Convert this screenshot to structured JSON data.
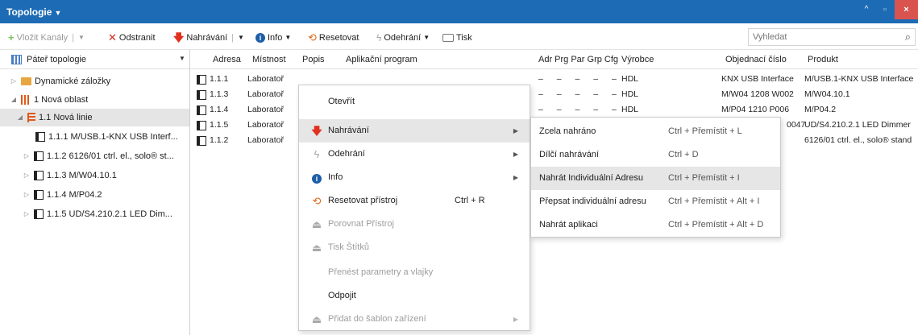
{
  "window": {
    "title": "Topologie",
    "controls": {
      "up": "^",
      "restore": "▫",
      "close": "×"
    }
  },
  "toolbar": {
    "add_channels": "Vložit Kanály",
    "remove": "Odstranit",
    "download": "Nahrávání",
    "info": "Info",
    "reset": "Resetovat",
    "unload": "Odehrání",
    "print": "Tisk",
    "search_placeholder": "Vyhledat"
  },
  "tree": {
    "header": "Páteř topologie",
    "items": [
      {
        "label": "Dynamické záložky"
      },
      {
        "label": "1 Nová oblast"
      },
      {
        "label": "1.1 Nová linie"
      },
      {
        "label": "1.1.1 M/USB.1-KNX USB Interf..."
      },
      {
        "label": "1.1.2 6126/01 ctrl. el., solo® st..."
      },
      {
        "label": "1.1.3 M/W04.10.1"
      },
      {
        "label": "1.1.4 M/P04.2"
      },
      {
        "label": "1.1.5 UD/S4.210.2.1 LED Dim..."
      }
    ]
  },
  "grid": {
    "columns": {
      "address": "Adresa",
      "room": "Místnost",
      "description": "Popis",
      "application": "Aplikační program",
      "flags": "Adr Prg Par Grp Cfg",
      "manufacturer": "Výrobce",
      "order": "Objednací číslo",
      "product": "Produkt"
    },
    "rows": [
      {
        "address": "1.1.1",
        "room": "Laboratoř",
        "flags": "– – – – –",
        "manufacturer": "HDL",
        "order": "KNX USB Interface",
        "product": "M/USB.1-KNX USB Interface"
      },
      {
        "address": "1.1.3",
        "room": "Laboratoř",
        "flags": "– – – – –",
        "manufacturer": "HDL",
        "order": "M/W04 1208 W002",
        "product": "M/W04.10.1"
      },
      {
        "address": "1.1.4",
        "room": "Laboratoř",
        "flags": "– – – – –",
        "manufacturer": "HDL",
        "order": "M/P04 1210 P006",
        "product": "M/P04.2"
      },
      {
        "address": "1.1.5",
        "room": "Laboratoř",
        "flags": "",
        "manufacturer": "",
        "order": "0047",
        "product": "UD/S4.210.2.1 LED Dimmer"
      },
      {
        "address": "1.1.2",
        "room": "Laboratoř",
        "flags": "",
        "manufacturer": "",
        "order": "",
        "product": "6126/01 ctrl. el., solo® stand"
      }
    ]
  },
  "context_menu": {
    "open": "Otevřít",
    "download": "Nahrávání",
    "unload": "Odehrání",
    "info": "Info",
    "reset_device": "Resetovat přístroj",
    "reset_shortcut": "Ctrl + R",
    "compare_device": "Porovnat Přístroj",
    "print_labels": "Tisk Štítků",
    "transfer_params": "Přenést parametry a vlajky",
    "disconnect": "Odpojit",
    "add_to_templates": "Přidat do šablon zařízení"
  },
  "submenu": {
    "items": [
      {
        "label": "Zcela nahráno",
        "shortcut": "Ctrl + Přemístit + L"
      },
      {
        "label": "Dílčí nahrávání",
        "shortcut": "Ctrl + D"
      },
      {
        "label": "Nahrát Individuální Adresu",
        "shortcut": "Ctrl + Přemístit + I"
      },
      {
        "label": "Přepsat individuální adresu",
        "shortcut": "Ctrl + Přemístit + Alt + I"
      },
      {
        "label": "Nahrát aplikaci",
        "shortcut": "Ctrl + Přemístit + Alt + D"
      }
    ]
  },
  "colors": {
    "titlebar": "#1d6bb5",
    "close": "#d9534f",
    "highlight": "#e6e6e6"
  }
}
